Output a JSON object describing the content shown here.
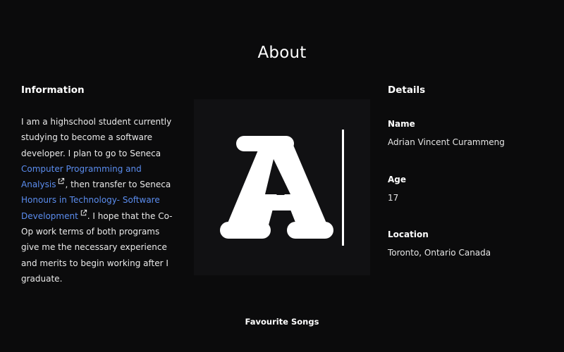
{
  "page": {
    "title": "About",
    "songs_heading": "Favourite Songs"
  },
  "information": {
    "heading": "Information",
    "text_1": "I am a highschool student currently studying to become a software developer. I plan to go to Seneca ",
    "link_1": "Computer Programming and Analysis",
    "text_2": ", then transfer to Seneca ",
    "link_2": "Honours in Technology- Software Development",
    "text_3": ". I hope that the Co-Op work terms of both programs give me the necessary experience and merits to begin working after I graduate."
  },
  "logo": {
    "letter": "A",
    "icon": "logo-letter-a-with-cursor"
  },
  "details": {
    "heading": "Details",
    "name_label": "Name",
    "name_value": "Adrian Vincent Curammeng",
    "age_label": "Age",
    "age_value": "17",
    "location_label": "Location",
    "location_value": "Toronto, Ontario Canada"
  },
  "colors": {
    "background": "#0b0b0c",
    "link": "#5b8def",
    "text": "#f2f2f2"
  }
}
